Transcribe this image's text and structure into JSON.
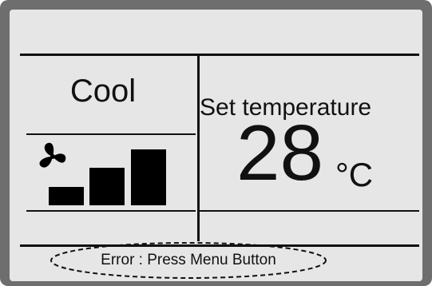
{
  "display": {
    "mode": "Cool",
    "set_temperature_label": "Set temperature",
    "temperature_value": "28",
    "temperature_unit": "°C",
    "fan_speed_level": 3,
    "fan_speed_levels_total": 3,
    "error_message": "Error : Press Menu Button"
  },
  "icons": {
    "fan": "fan-icon"
  },
  "colors": {
    "bezel": "#6e6e6e",
    "screen_background": "#e6e6e6",
    "segments": "#000000"
  }
}
